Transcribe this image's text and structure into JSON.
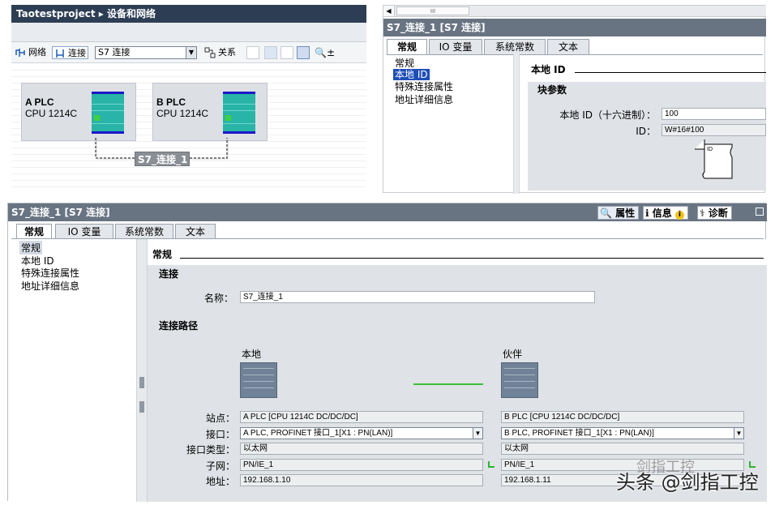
{
  "network": {
    "title": "Taotestproject ▸ 设备和网络",
    "toolbar": {
      "network_label": "网络",
      "connect_label": "连接",
      "connection_select": "S7 连接",
      "relation_label": "关系"
    },
    "devices": [
      {
        "name": "A PLC",
        "cpu": "CPU 1214C"
      },
      {
        "name": "B PLC",
        "cpu": "CPU 1214C"
      }
    ],
    "connection_label": "S7_连接_1"
  },
  "localid_panel": {
    "scroll_thumb": "III",
    "title": "S7_连接_1 [S7 连接]",
    "tabs": [
      "常规",
      "IO 变量",
      "系统常数",
      "文本"
    ],
    "nav": [
      "常规",
      "本地 ID",
      "特殊连接属性",
      "地址详细信息"
    ],
    "selected_nav": "本地 ID",
    "section": "本地 ID",
    "subsection": "块参数",
    "local_id_label": "本地 ID（十六进制）：",
    "local_id_value": "100",
    "id_label": "ID：",
    "id_value": "W#16#100",
    "block_pin": "ID"
  },
  "props_panel": {
    "title": "S7_连接_1 [S7 连接]",
    "right_tabs": {
      "properties": "属性",
      "info": "信息",
      "diagnostics": "诊断"
    },
    "tabs": [
      "常规",
      "IO 变量",
      "系统常数",
      "文本"
    ],
    "nav": [
      "常规",
      "本地 ID",
      "特殊连接属性",
      "地址详细信息"
    ],
    "selected_nav": "常规",
    "section": "常规",
    "connection_head": "连接",
    "name_label": "名称：",
    "name_value": "S7_连接_1",
    "path_head": "连接路径",
    "local_head": "本地",
    "partner_head": "伙伴",
    "rows": {
      "station_label": "站点：",
      "interface_label": "接口：",
      "iface_type_label": "接口类型：",
      "subnet_label": "子网：",
      "address_label": "地址："
    },
    "local": {
      "station": "A PLC [CPU 1214C DC/DC/DC]",
      "interface": "A PLC, PROFINET 接口_1[X1 : PN(LAN)]",
      "iface_type": "以太网",
      "subnet": "PN/IE_1",
      "address": "192.168.1.10"
    },
    "partner": {
      "station": "B PLC [CPU 1214C DC/DC/DC]",
      "interface": "B PLC, PROFINET 接口_1[X1 : PN(LAN)]",
      "iface_type": "以太网",
      "subnet": "PN/IE_1",
      "address": "192.168.1.11"
    }
  },
  "watermark": "头条 @剑指工控",
  "watermark_top": "剑指工控"
}
